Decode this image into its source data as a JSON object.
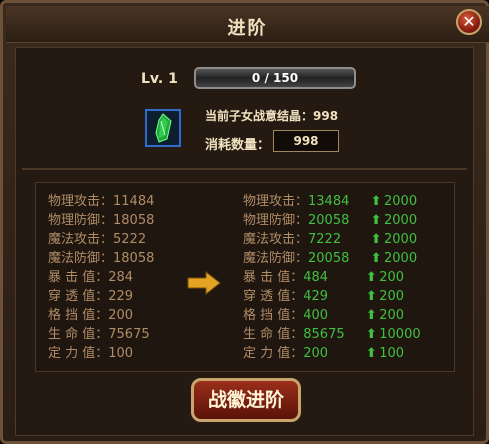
{
  "dialog": {
    "title": "进阶",
    "close_label": "✕"
  },
  "level": {
    "label": "Lv. 1",
    "progress_text": "0 / 150",
    "progress_fraction": 0.0
  },
  "material": {
    "icon": "green-crystal-icon",
    "owned_text": "当前子女战意结晶：998",
    "cost_label": "消耗数量：",
    "cost_value": "998"
  },
  "stats": {
    "current": [
      {
        "label": "物理攻击：",
        "value": "11484"
      },
      {
        "label": "物理防御：",
        "value": "18058"
      },
      {
        "label": "魔法攻击：",
        "value": "5222"
      },
      {
        "label": "魔法防御：",
        "value": "18058"
      },
      {
        "label": "暴 击 值：",
        "value": "284"
      },
      {
        "label": "穿 透 值：",
        "value": "229"
      },
      {
        "label": "格 挡 值：",
        "value": "200"
      },
      {
        "label": "生 命 值：",
        "value": "75675"
      },
      {
        "label": "定 力 值：",
        "value": "100"
      }
    ],
    "next": [
      {
        "label": "物理攻击：",
        "value": "13484",
        "increase": "2000"
      },
      {
        "label": "物理防御：",
        "value": "20058",
        "increase": "2000"
      },
      {
        "label": "魔法攻击：",
        "value": "7222",
        "increase": "2000"
      },
      {
        "label": "魔法防御：",
        "value": "20058",
        "increase": "2000"
      },
      {
        "label": "暴 击 值：",
        "value": "484",
        "increase": "200"
      },
      {
        "label": "穿 透 值：",
        "value": "429",
        "increase": "200"
      },
      {
        "label": "格 挡 值：",
        "value": "400",
        "increase": "200"
      },
      {
        "label": "生 命 值：",
        "value": "85675",
        "increase": "10000"
      },
      {
        "label": "定 力 值：",
        "value": "200",
        "increase": "100"
      }
    ]
  },
  "action": {
    "button_label": "战徽进阶"
  },
  "colors": {
    "stat_label": "#b08c67",
    "stat_increase": "#40c040",
    "accent_gold": "#c9a36c"
  }
}
